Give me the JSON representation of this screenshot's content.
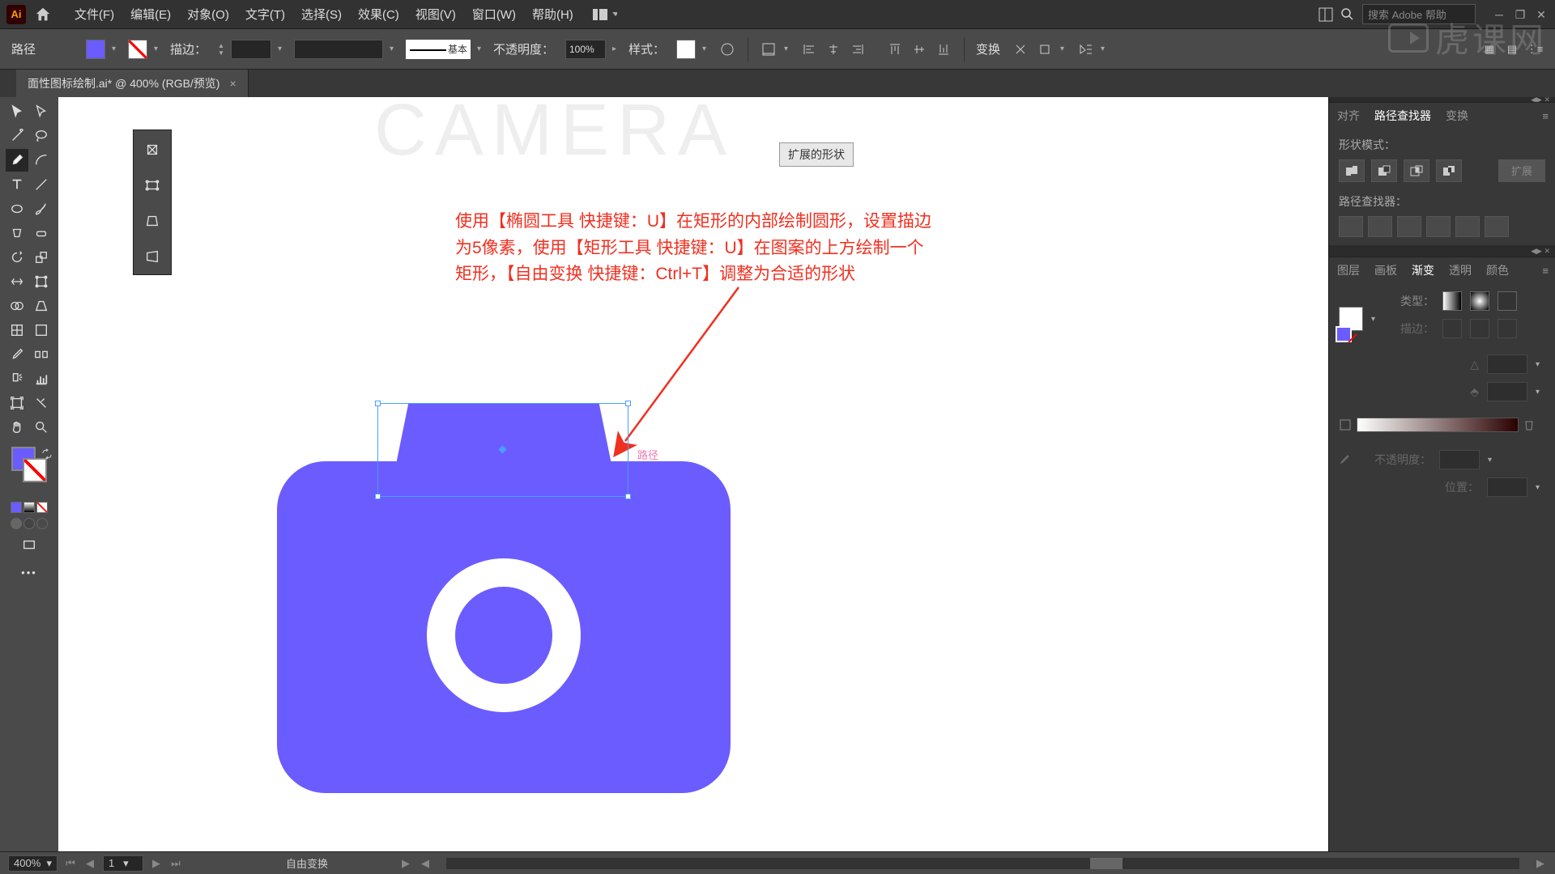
{
  "menu": {
    "file": "文件(F)",
    "edit": "编辑(E)",
    "object": "对象(O)",
    "type": "文字(T)",
    "select": "选择(S)",
    "effect": "效果(C)",
    "view": "视图(V)",
    "window": "窗口(W)",
    "help": "帮助(H)"
  },
  "search_placeholder": "搜索 Adobe 帮助",
  "control": {
    "selection": "路径",
    "stroke_label": "描边：",
    "profile": "基本",
    "opacity_label": "不透明度：",
    "opacity_value": "100%",
    "style_label": "样式：",
    "transform": "变换"
  },
  "tab": {
    "name": "面性图标绘制.ai* @ 400% (RGB/预览)"
  },
  "canvas": {
    "expand_btn": "扩展的形状",
    "annotation_l1": "使用【椭圆工具 快捷键：U】在矩形的内部绘制圆形，设置描边",
    "annotation_l2": "为5像素，使用【矩形工具 快捷键：U】在图案的上方绘制一个",
    "annotation_l3": "矩形，【自由变换 快捷键：Ctrl+T】调整为合适的形状",
    "path_label": "路径",
    "bg_title": "CAMERA"
  },
  "panels": {
    "align": "对齐",
    "pathfinder": "路径查找器",
    "transform": "变换",
    "shape_modes": "形状模式：",
    "pathfinders": "路径查找器：",
    "expand": "扩展",
    "layers": "图层",
    "artboards": "画板",
    "gradient": "渐变",
    "transparency": "透明",
    "color": "颜色",
    "type_label": "类型：",
    "stroke_label": "描边：",
    "opacity_label": "不透明度：",
    "position_label": "位置："
  },
  "status": {
    "zoom": "400%",
    "artboard": "1",
    "tool": "自由变换"
  },
  "watermark": "虎课网",
  "colors": {
    "accent": "#6b5cff"
  }
}
